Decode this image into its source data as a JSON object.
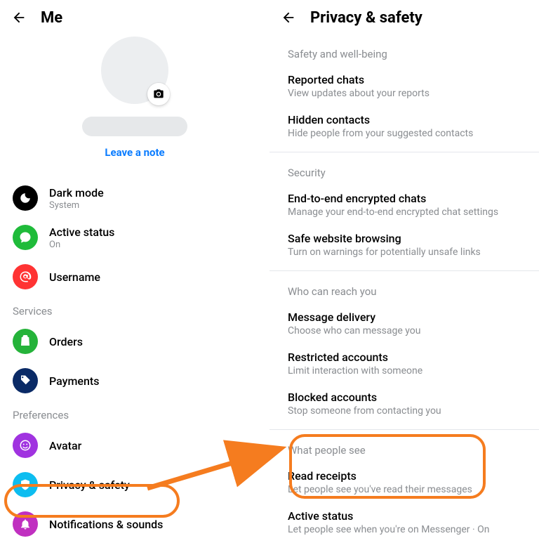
{
  "left": {
    "header_title": "Me",
    "leave_note": "Leave a note",
    "rows": {
      "dark_mode": {
        "title": "Dark mode",
        "sub": "System"
      },
      "active_status": {
        "title": "Active status",
        "sub": "On"
      },
      "username": {
        "title": "Username"
      }
    },
    "section_services": "Services",
    "orders": {
      "title": "Orders"
    },
    "payments": {
      "title": "Payments"
    },
    "section_prefs": "Preferences",
    "avatar": {
      "title": "Avatar"
    },
    "privacy": {
      "title": "Privacy & safety"
    },
    "notifications": {
      "title": "Notifications & sounds"
    }
  },
  "right": {
    "header_title": "Privacy & safety",
    "s1": "Safety and well-being",
    "reported": {
      "title": "Reported chats",
      "desc": "View updates about your reports"
    },
    "hidden": {
      "title": "Hidden contacts",
      "desc": "Hide people from your suggested contacts"
    },
    "s2": "Security",
    "e2e": {
      "title": "End-to-end encrypted chats",
      "desc": "Manage your end-to-end encrypted chat settings"
    },
    "safe_browsing": {
      "title": "Safe website browsing",
      "desc": "Turn on warnings for potentially unsafe links"
    },
    "s3": "Who can reach you",
    "delivery": {
      "title": "Message delivery",
      "desc": "Choose who can message you"
    },
    "restricted": {
      "title": "Restricted accounts",
      "desc": "Limit interaction with someone"
    },
    "blocked": {
      "title": "Blocked accounts",
      "desc": "Stop someone from contacting you"
    },
    "s4": "What people see",
    "read_receipts": {
      "title": "Read receipts",
      "desc": "Let people see you've read their messages"
    },
    "active_status": {
      "title": "Active status",
      "desc": "Let people see when you're on Messenger · On"
    }
  }
}
